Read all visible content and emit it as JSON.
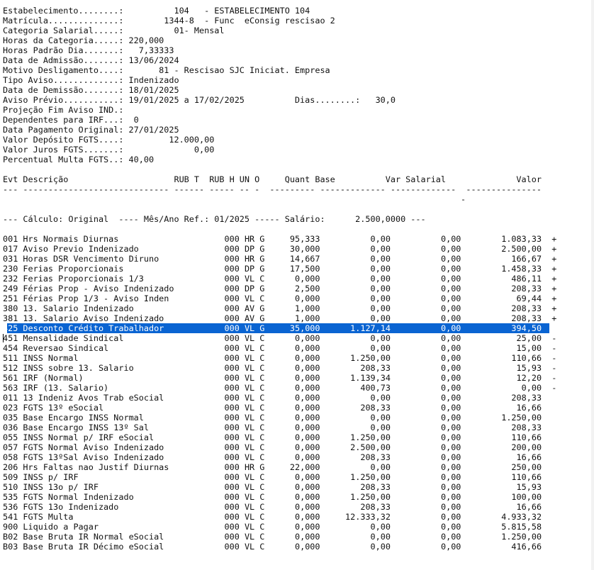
{
  "header": [
    "Estabelecimento........:          104   - ESTABELECIMENTO 104",
    "Matrícula..............:        1344-8  - Func  eConsig rescisao 2",
    "Categoria Salarial.....:          01- Mensal",
    "Horas da Categoria.....: 220,000",
    "Horas Padrão Dia.......:   7,33333",
    "Data de Admissão.......: 13/06/2024",
    "Motivo Desligamento....:       81 - Rescisao SJC Iniciat. Empresa",
    "Tipo Aviso.............: Indenizado",
    "Data de Demissão.......: 18/01/2025",
    "Aviso Prévio...........: 19/01/2025 a 17/02/2025          Dias........:   30,0",
    "Projeção Fim Aviso IND.:",
    "Dependentes para IRF...:  0",
    "Data Pagamento Original: 27/01/2025",
    "Valor Depósito FGTS....:         12.000,00",
    "Valor Juros FGTS.......:              0,00",
    "Percentual Multa FGTS..: 40,00"
  ],
  "columns_header": "Evt Descrição                     RUB T  RUB H UN O     Quant Base          Var Salarial              Valor",
  "columns_rule": "--- ----------------------------- ------ ----- -- -  --------- ------------- -------------  ---------------",
  "rule_tail": "-",
  "calc_line": "--- Cálculo: Original  ---- Mês/Ano Ref.: 01/2025 ----- Salário:      2.500,0000 ---",
  "rows": [
    {
      "evt": "001",
      "desc": "Hrs Normais Diurnas",
      "rubt": "",
      "rubh": "000",
      "un": "HR",
      "o": "G",
      "quant": "95,333",
      "base": "0,00",
      "var": "0,00",
      "valor": "1.083,33",
      "sign": "+"
    },
    {
      "evt": "017",
      "desc": "Aviso Previo Indenizado",
      "rubt": "",
      "rubh": "000",
      "un": "DP",
      "o": "G",
      "quant": "30,000",
      "base": "0,00",
      "var": "0,00",
      "valor": "2.500,00",
      "sign": "+"
    },
    {
      "evt": "031",
      "desc": "Horas DSR Vencimento Diruno",
      "rubt": "",
      "rubh": "000",
      "un": "HR",
      "o": "G",
      "quant": "14,667",
      "base": "0,00",
      "var": "0,00",
      "valor": "166,67",
      "sign": "+"
    },
    {
      "evt": "230",
      "desc": "Ferias Proporcionais",
      "rubt": "",
      "rubh": "000",
      "un": "DP",
      "o": "G",
      "quant": "17,500",
      "base": "0,00",
      "var": "0,00",
      "valor": "1.458,33",
      "sign": "+"
    },
    {
      "evt": "232",
      "desc": "Ferias Proporcionais 1/3",
      "rubt": "",
      "rubh": "000",
      "un": "VL",
      "o": "C",
      "quant": "0,000",
      "base": "0,00",
      "var": "0,00",
      "valor": "486,11",
      "sign": "+"
    },
    {
      "evt": "249",
      "desc": "Férias Prop - Aviso Indenizado",
      "rubt": "",
      "rubh": "000",
      "un": "DP",
      "o": "G",
      "quant": "2,500",
      "base": "0,00",
      "var": "0,00",
      "valor": "208,33",
      "sign": "+"
    },
    {
      "evt": "251",
      "desc": "Férias Prop 1/3 - Aviso Inden",
      "rubt": "",
      "rubh": "000",
      "un": "VL",
      "o": "C",
      "quant": "0,000",
      "base": "0,00",
      "var": "0,00",
      "valor": "69,44",
      "sign": "+"
    },
    {
      "evt": "380",
      "desc": "13. Salario Indenizado",
      "rubt": "",
      "rubh": "000",
      "un": "AV",
      "o": "G",
      "quant": "1,000",
      "base": "0,00",
      "var": "0,00",
      "valor": "208,33",
      "sign": "+"
    },
    {
      "evt": "381",
      "desc": "13. Salario Aviso Indenizado",
      "rubt": "",
      "rubh": "000",
      "un": "AV",
      "o": "G",
      "quant": "1,000",
      "base": "0,00",
      "var": "0,00",
      "valor": "208,33",
      "sign": "+"
    },
    {
      "evt": "425",
      "desc": "Desconto Crédito Trabalhador",
      "rubt": "",
      "rubh": "000",
      "un": "VL",
      "o": "G",
      "quant": "35,000",
      "base": "1.127,14",
      "var": "0,00",
      "valor": "394,50",
      "sign": "-",
      "selected": true
    },
    {
      "evt": "451",
      "desc": "Mensalidade Sindical",
      "rubt": "",
      "rubh": "000",
      "un": "VL",
      "o": "C",
      "quant": "0,000",
      "base": "0,00",
      "var": "0,00",
      "valor": "25,00",
      "sign": "-"
    },
    {
      "evt": "454",
      "desc": "Reversao Sindical",
      "rubt": "",
      "rubh": "000",
      "un": "VL",
      "o": "C",
      "quant": "0,000",
      "base": "0,00",
      "var": "0,00",
      "valor": "15,00",
      "sign": "-"
    },
    {
      "evt": "511",
      "desc": "INSS Normal",
      "rubt": "",
      "rubh": "000",
      "un": "VL",
      "o": "C",
      "quant": "0,000",
      "base": "1.250,00",
      "var": "0,00",
      "valor": "110,66",
      "sign": "-"
    },
    {
      "evt": "512",
      "desc": "INSS sobre 13. Salario",
      "rubt": "",
      "rubh": "000",
      "un": "VL",
      "o": "C",
      "quant": "0,000",
      "base": "208,33",
      "var": "0,00",
      "valor": "15,93",
      "sign": "-"
    },
    {
      "evt": "561",
      "desc": "IRF (Normal)",
      "rubt": "",
      "rubh": "000",
      "un": "VL",
      "o": "C",
      "quant": "0,000",
      "base": "1.139,34",
      "var": "0,00",
      "valor": "12,20",
      "sign": "-"
    },
    {
      "evt": "563",
      "desc": "IRF (13. Salario)",
      "rubt": "",
      "rubh": "000",
      "un": "VL",
      "o": "C",
      "quant": "0,000",
      "base": "400,73",
      "var": "0,00",
      "valor": "0,00",
      "sign": "-"
    },
    {
      "evt": "011",
      "desc": "13 Indeniz Avos Trab eSocial",
      "rubt": "",
      "rubh": "000",
      "un": "VL",
      "o": "C",
      "quant": "0,000",
      "base": "0,00",
      "var": "0,00",
      "valor": "208,33",
      "sign": ""
    },
    {
      "evt": "023",
      "desc": "FGTS 13º eSocial",
      "rubt": "",
      "rubh": "000",
      "un": "VL",
      "o": "C",
      "quant": "0,000",
      "base": "208,33",
      "var": "0,00",
      "valor": "16,66",
      "sign": ""
    },
    {
      "evt": "035",
      "desc": "Base Encargo INSS Normal",
      "rubt": "",
      "rubh": "000",
      "un": "VL",
      "o": "C",
      "quant": "0,000",
      "base": "0,00",
      "var": "0,00",
      "valor": "1.250,00",
      "sign": ""
    },
    {
      "evt": "036",
      "desc": "Base Encargo INSS 13º Sal",
      "rubt": "",
      "rubh": "000",
      "un": "VL",
      "o": "C",
      "quant": "0,000",
      "base": "0,00",
      "var": "0,00",
      "valor": "208,33",
      "sign": ""
    },
    {
      "evt": "055",
      "desc": "INSS Normal p/ IRF eSocial",
      "rubt": "",
      "rubh": "000",
      "un": "VL",
      "o": "C",
      "quant": "0,000",
      "base": "1.250,00",
      "var": "0,00",
      "valor": "110,66",
      "sign": ""
    },
    {
      "evt": "057",
      "desc": "FGTS Normal Aviso Indenizado",
      "rubt": "",
      "rubh": "000",
      "un": "VL",
      "o": "C",
      "quant": "0,000",
      "base": "2.500,00",
      "var": "0,00",
      "valor": "200,00",
      "sign": ""
    },
    {
      "evt": "058",
      "desc": "FGTS 13ºSal Aviso Indenizado",
      "rubt": "",
      "rubh": "000",
      "un": "VL",
      "o": "C",
      "quant": "0,000",
      "base": "208,33",
      "var": "0,00",
      "valor": "16,66",
      "sign": ""
    },
    {
      "evt": "206",
      "desc": "Hrs Faltas nao Justif Diurnas",
      "rubt": "",
      "rubh": "000",
      "un": "HR",
      "o": "G",
      "quant": "22,000",
      "base": "0,00",
      "var": "0,00",
      "valor": "250,00",
      "sign": ""
    },
    {
      "evt": "509",
      "desc": "INSS p/ IRF",
      "rubt": "",
      "rubh": "000",
      "un": "VL",
      "o": "C",
      "quant": "0,000",
      "base": "1.250,00",
      "var": "0,00",
      "valor": "110,66",
      "sign": ""
    },
    {
      "evt": "510",
      "desc": "INSS 13o p/ IRF",
      "rubt": "",
      "rubh": "000",
      "un": "VL",
      "o": "C",
      "quant": "0,000",
      "base": "208,33",
      "var": "0,00",
      "valor": "15,93",
      "sign": ""
    },
    {
      "evt": "535",
      "desc": "FGTS Normal Indenizado",
      "rubt": "",
      "rubh": "000",
      "un": "VL",
      "o": "C",
      "quant": "0,000",
      "base": "1.250,00",
      "var": "0,00",
      "valor": "100,00",
      "sign": ""
    },
    {
      "evt": "536",
      "desc": "FGTS 13o Indenizado",
      "rubt": "",
      "rubh": "000",
      "un": "VL",
      "o": "C",
      "quant": "0,000",
      "base": "208,33",
      "var": "0,00",
      "valor": "16,66",
      "sign": ""
    },
    {
      "evt": "541",
      "desc": "FGTS Multa",
      "rubt": "",
      "rubh": "000",
      "un": "VL",
      "o": "C",
      "quant": "0,000",
      "base": "12.333,32",
      "var": "0,00",
      "valor": "4.933,32",
      "sign": ""
    },
    {
      "evt": "900",
      "desc": "Liquido a Pagar",
      "rubt": "",
      "rubh": "000",
      "un": "VL",
      "o": "C",
      "quant": "0,000",
      "base": "0,00",
      "var": "0,00",
      "valor": "5.815,58",
      "sign": ""
    },
    {
      "evt": "B02",
      "desc": "Base Bruta IR Normal eSocial",
      "rubt": "",
      "rubh": "000",
      "un": "VL",
      "o": "C",
      "quant": "0,000",
      "base": "0,00",
      "var": "0,00",
      "valor": "1.250,00",
      "sign": ""
    },
    {
      "evt": "B03",
      "desc": "Base Bruta IR Décimo eSocial",
      "rubt": "",
      "rubh": "000",
      "un": "VL",
      "o": "C",
      "quant": "0,000",
      "base": "0,00",
      "var": "0,00",
      "valor": "416,66",
      "sign": ""
    }
  ]
}
